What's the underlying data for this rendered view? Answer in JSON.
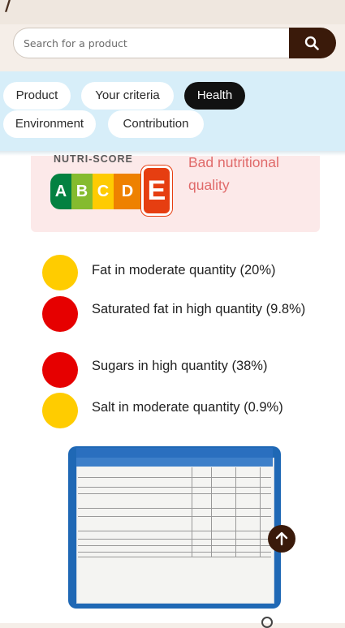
{
  "search": {
    "placeholder": "Search for a product",
    "value": ""
  },
  "tabs": [
    {
      "label": "Product",
      "active": false
    },
    {
      "label": "Your criteria",
      "active": false
    },
    {
      "label": "Health",
      "active": true
    },
    {
      "label": "Environment",
      "active": false
    },
    {
      "label": "Contribution",
      "active": false
    }
  ],
  "nutriscore": {
    "label": "NUTRI-SCORE",
    "grades": [
      "A",
      "B",
      "C",
      "D",
      "E"
    ],
    "selected_grade": "E",
    "description": "Bad nutritional quality"
  },
  "nutrient_levels": [
    {
      "text": "Fat in moderate quantity (20%)",
      "level": "moderate",
      "color": "#ffcc00"
    },
    {
      "text": "Saturated fat in high quantity (9.8%)",
      "level": "high",
      "color": "#e60000"
    },
    {
      "text": "Sugars in high quantity (38%)",
      "level": "high",
      "color": "#e60000"
    },
    {
      "text": "Salt in moderate quantity (0.9%)",
      "level": "moderate",
      "color": "#ffcc00"
    }
  ],
  "colors": {
    "brand_dark": "#3a1a0a",
    "tabs_bg": "#d7eef9",
    "grade_a": "#038141",
    "grade_b": "#85bb2f",
    "grade_c": "#fecb02",
    "grade_d": "#ee8100",
    "grade_e": "#e63e11"
  },
  "icons": {
    "search": "search-icon",
    "scroll_top": "arrow-up-icon"
  }
}
